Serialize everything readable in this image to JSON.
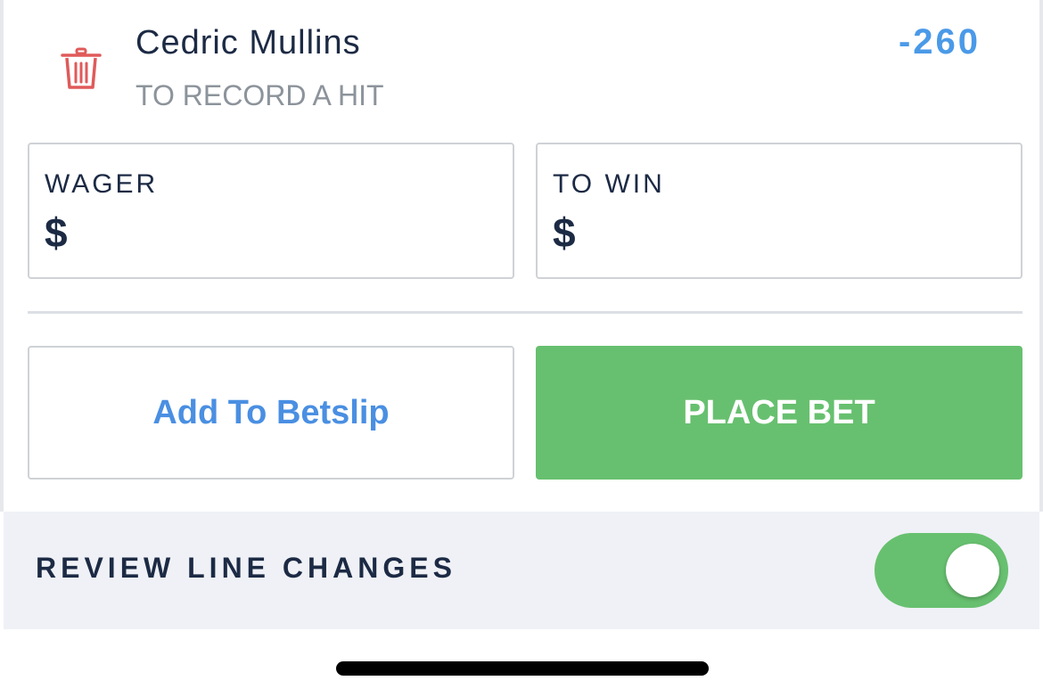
{
  "bet": {
    "player_name": "Cedric Mullins",
    "market": "TO RECORD A HIT",
    "odds": "-260",
    "delete_icon": "trash-icon"
  },
  "wager": {
    "label": "WAGER",
    "currency": "$",
    "value": ""
  },
  "to_win": {
    "label": "TO WIN",
    "currency": "$",
    "value": ""
  },
  "actions": {
    "add_to_betslip_label": "Add To Betslip",
    "place_bet_label": "PLACE BET"
  },
  "review_line_changes": {
    "label": "REVIEW LINE CHANGES",
    "enabled": true
  },
  "colors": {
    "accent_blue": "#4a9ae8",
    "place_bet_green": "#67c06f",
    "delete_red": "#e05a5a",
    "text_dark": "#1c2a44",
    "text_muted": "#8c939b",
    "review_bar_bg": "#eff1f6"
  }
}
